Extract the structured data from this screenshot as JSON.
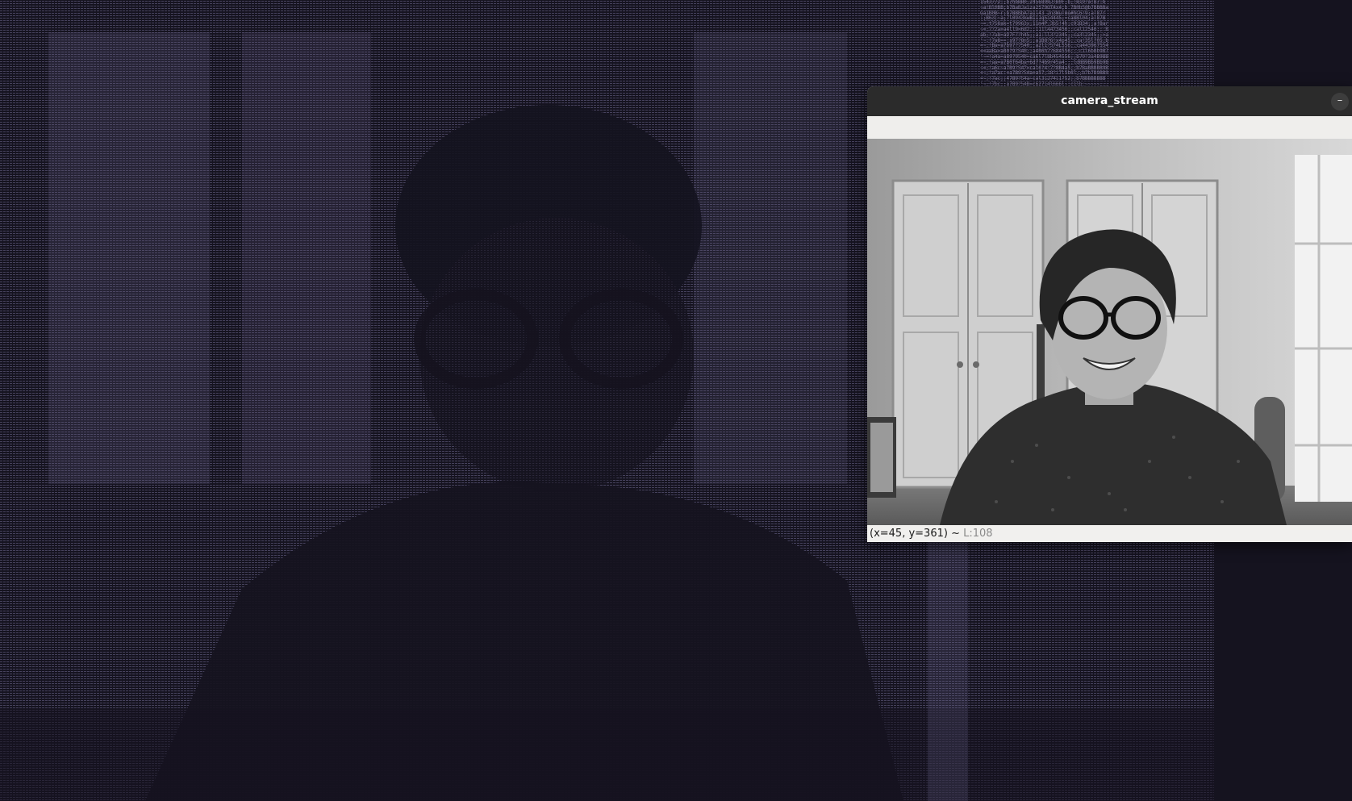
{
  "window": {
    "title": "camera_stream",
    "minimize_label": "–"
  },
  "status": {
    "coords": "(x=45, y=361) ~ ",
    "luminance": "L:108"
  },
  "terminal": {
    "ascii_lines": [
      "1543772:;b7hbBB0;2456898JTB0F;b;!B19?a!B7:b",
      "~a!Bl0BB;b7BaBJa1za2S79OT4x4;b 7B0b5@b7BBBBa",
      "Ga1B0B~r;b7BBBbA7a1l43 2n3Wu!mo#hC6!9;a!87r",
      ":;B63|~a;7l0943kwB111q5i4445;=ca8Bl04;a!87B",
      "~=;t7S8ak=t79963x;11m4P;3b5!4h;c91B34;;a!Bar",
      "~=;7?2a=a4ll9=6d2;;111l4473456;;cal12546;;:B",
      "ab;!7a8=aD7F7?h45;;a1:ll3?2345;;ca3l2345;;>a",
      "'~:!7a8==;s97?8n5;;a1B8?6!x4p45;;ca!35l?05;b",
      "=~;!Ba=a7b97?7540;;a2l1?574L556;;ca443967554",
      "==aaBa=aB0?9?540;;a4B6h7?684556;;;c1l6bBb9B7",
      "'~=!a4a=a89?9540=ca6l7l8b454556;;b79?3a4B9BB",
      "=~;!aa=a7B0T64ba+6d7?4b9r45a4;;;ld8B9Bb9Bb9B",
      "~=;!a6c~a7B9?547=cal6?4!7?8B4a5;;b7BaBBBBB9B",
      "=~;!a7ac:=a7B9?54a=a57;18?i7l5b6l;;b7b7B9BB9",
      "=~;!7ac;;47B9?54a~cal3i274i1?52;;b7BBBBBBBB",
      "'~;!7bc;;a7B9?54B=c627i4l666l~:c1lb:~~~~~;;;"
    ]
  }
}
